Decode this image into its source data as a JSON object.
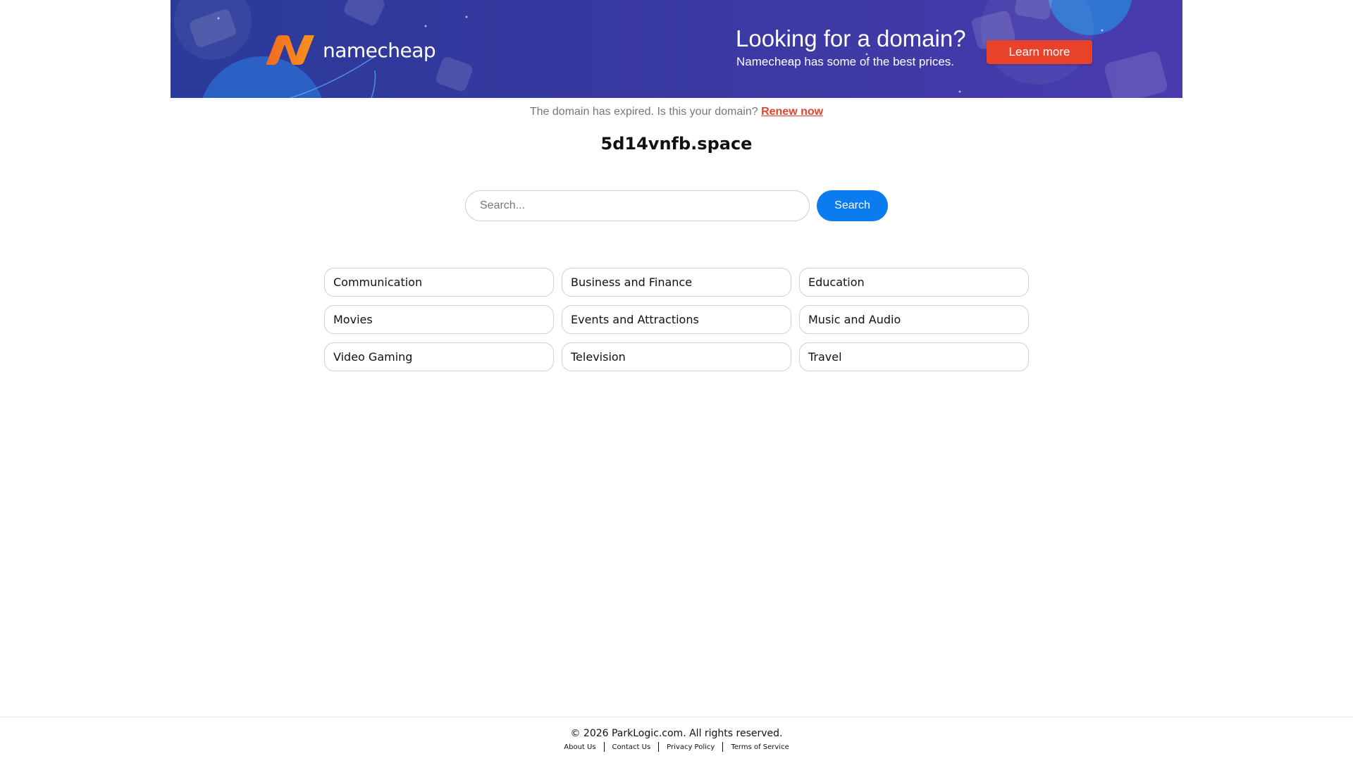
{
  "banner": {
    "brand_name": "namecheap",
    "promo_title": "Looking for a domain?",
    "promo_subtitle": "Namecheap has some of the best prices.",
    "cta_label": "Learn more",
    "colors": {
      "background": "#36389f",
      "logo_orange": "#f26a21",
      "cta": "#e8432a"
    }
  },
  "notice": {
    "text": "The domain has expired. Is this your domain?",
    "link_label": "Renew now"
  },
  "domain": {
    "name": "5d14vnfb.space"
  },
  "search": {
    "placeholder": "Search...",
    "value": "",
    "button_label": "Search",
    "button_color": "#0a7cf0"
  },
  "categories": [
    "Communication",
    "Business and Finance",
    "Education",
    "Movies",
    "Events and Attractions",
    "Music and Audio",
    "Video Gaming",
    "Television",
    "Travel"
  ],
  "footer": {
    "copyright": "© 2026 ParkLogic.com. All rights reserved.",
    "links": [
      "About Us",
      "Contact Us",
      "Privacy Policy",
      "Terms of Service"
    ]
  }
}
